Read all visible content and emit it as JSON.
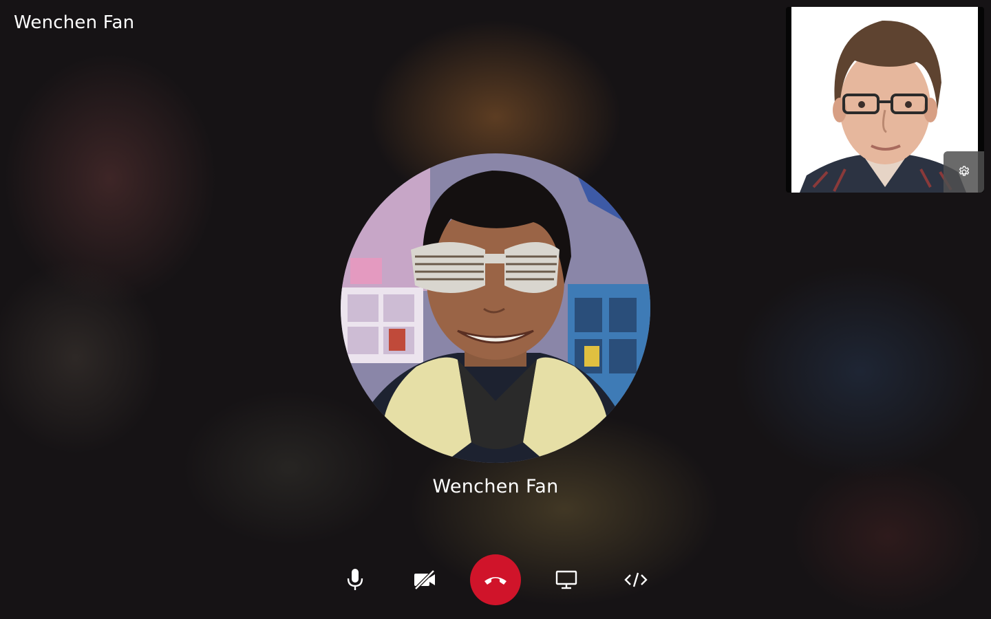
{
  "call": {
    "caller_name": "Wenchen Fan"
  },
  "self_view": {
    "settings_icon": "gear-icon"
  },
  "controls": {
    "items": [
      {
        "icon": "microphone-icon"
      },
      {
        "icon": "camera-off-icon"
      },
      {
        "icon": "hang-up-icon",
        "color": "#d0142a"
      },
      {
        "icon": "screen-share-icon"
      },
      {
        "icon": "code-icon"
      }
    ]
  },
  "colors": {
    "hangup": "#d0142a",
    "text": "#ffffff"
  }
}
